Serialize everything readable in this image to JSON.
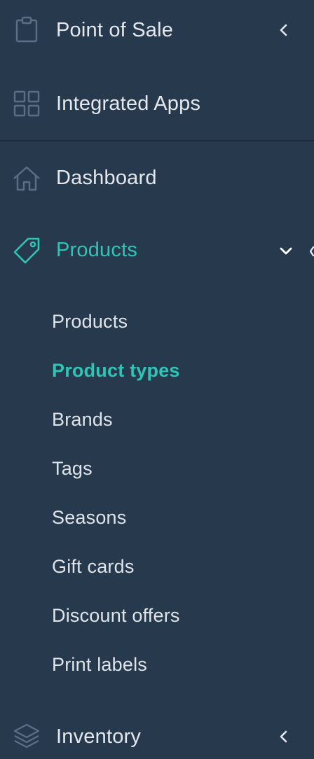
{
  "sidebar": {
    "items": [
      {
        "label": "Point of Sale",
        "icon": "clipboard-icon",
        "expanded": false
      },
      {
        "label": "Integrated Apps",
        "icon": "grid-icon"
      },
      {
        "label": "Dashboard",
        "icon": "home-icon"
      },
      {
        "label": "Products",
        "icon": "tag-icon",
        "expanded": true,
        "active": true
      },
      {
        "label": "Inventory",
        "icon": "layers-icon",
        "expanded": false
      }
    ],
    "products_submenu": [
      {
        "label": "Products"
      },
      {
        "label": "Product types",
        "active": true
      },
      {
        "label": "Brands"
      },
      {
        "label": "Tags"
      },
      {
        "label": "Seasons"
      },
      {
        "label": "Gift cards"
      },
      {
        "label": "Discount offers"
      },
      {
        "label": "Print labels"
      }
    ]
  },
  "colors": {
    "background": "#273a4d",
    "accent": "#2ec4b6",
    "text": "#e4e8ee",
    "icon": "#5a6e85",
    "divider": "#1c2b3a"
  }
}
